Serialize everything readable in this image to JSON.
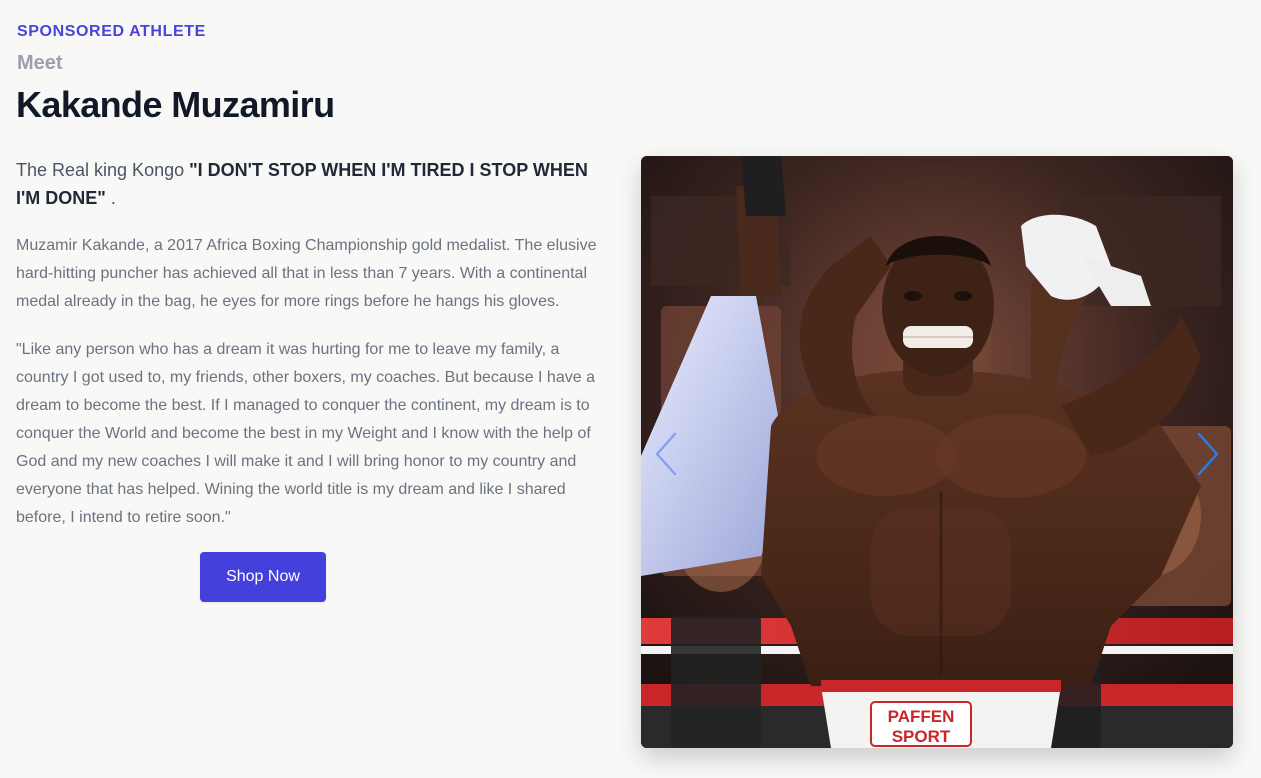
{
  "header": {
    "eyebrow": "SPONSORED ATHLETE",
    "meet": "Meet",
    "name": "Kakande Muzamiru"
  },
  "intro": {
    "prefix": "The Real king Kongo ",
    "quote": "\"I DON'T STOP WHEN I'M TIRED I STOP WHEN I'M DONE\"",
    "suffix": " ."
  },
  "paragraphs": [
    "Muzamir Kakande, a 2017 Africa Boxing Championship gold medalist. The elusive hard-hitting puncher has achieved all that in less than 7 years. With a continental medal already in the bag, he eyes for more rings before he hangs his gloves.",
    "\"Like any person who has a dream it was hurting for me to leave my family, a country I got used to, my friends, other boxers, my coaches. But because I have a dream to become the best. If I managed to conquer the continent, my dream is to conquer the World and become the best in my Weight and I know with the help of God and my new coaches I will make it and I will bring honor to my country and everyone that has helped. Wining the world title is my dream and like I shared before, I intend to retire soon.\""
  ],
  "cta": {
    "label": "Shop Now"
  },
  "carousel": {
    "prev_icon": "chevron-left-icon",
    "next_icon": "chevron-right-icon",
    "trunks_text_line1": "PAFFEN",
    "trunks_text_line2": "SPORT"
  },
  "colors": {
    "accent": "#4440dc",
    "eyebrow": "#4a43dc",
    "background": "#f8f8f7",
    "arrow": "#2b7de9"
  }
}
